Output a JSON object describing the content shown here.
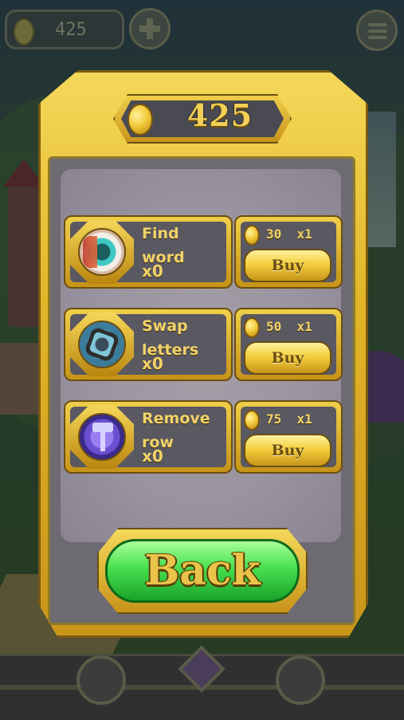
{
  "hud": {
    "coins": "425"
  },
  "shop": {
    "coin_total": "425",
    "items": [
      {
        "name_line1": "Find",
        "name_line2": "word",
        "count": "x0",
        "price": "30",
        "qty": "x1",
        "buy_label": "Buy",
        "icon": "eye-icon"
      },
      {
        "name_line1": "Swap",
        "name_line2": "letters",
        "count": "x0",
        "price": "50",
        "qty": "x1",
        "buy_label": "Buy",
        "icon": "swap-letters-icon"
      },
      {
        "name_line1": "Remove",
        "name_line2": "row",
        "count": "x0",
        "price": "75",
        "qty": "x1",
        "buy_label": "Buy",
        "icon": "hammer-icon"
      }
    ],
    "back_label": "Back"
  },
  "colors": {
    "gold": "#e2b628",
    "panel_gray": "#6e6a72",
    "back_green": "#48e04f"
  }
}
